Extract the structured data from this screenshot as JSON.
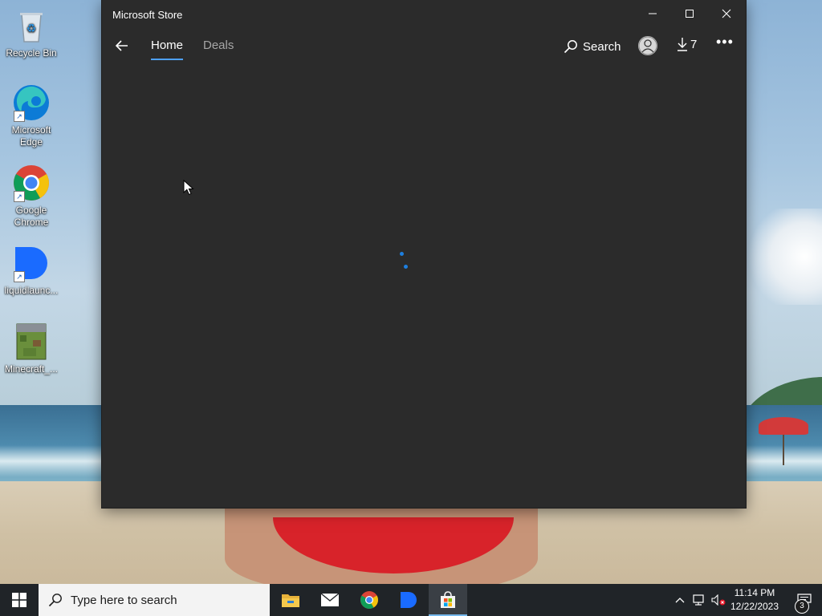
{
  "desktop": {
    "icons": [
      {
        "label": "Recycle Bin",
        "icon": "recycle-bin-icon"
      },
      {
        "label": "Microsoft Edge",
        "icon": "edge-icon"
      },
      {
        "label": "Google Chrome",
        "icon": "chrome-icon"
      },
      {
        "label": "liquidlaunc...",
        "icon": "liquidlauncher-icon"
      },
      {
        "label": "Minecraft_...",
        "icon": "minecraft-icon"
      }
    ]
  },
  "window": {
    "title": "Microsoft Store",
    "nav": {
      "tabs": [
        {
          "label": "Home",
          "selected": true
        },
        {
          "label": "Deals",
          "selected": false
        }
      ],
      "search_label": "Search",
      "downloads_count": "7",
      "more_label": "•••"
    },
    "loading": true
  },
  "taskbar": {
    "search_placeholder": "Type here to search",
    "pinned": [
      "file-explorer-icon",
      "mail-icon",
      "chrome-icon",
      "liquidlauncher-icon",
      "microsoft-store-icon"
    ],
    "active_app": "microsoft-store-icon",
    "clock": {
      "time": "11:14 PM",
      "date": "12/22/2023"
    },
    "notification_count": "3"
  },
  "colors": {
    "accent": "#4ea1ff",
    "window_bg": "#2b2b2b",
    "spinner": "#1d7fe0",
    "taskbar_bg": "#202428"
  }
}
